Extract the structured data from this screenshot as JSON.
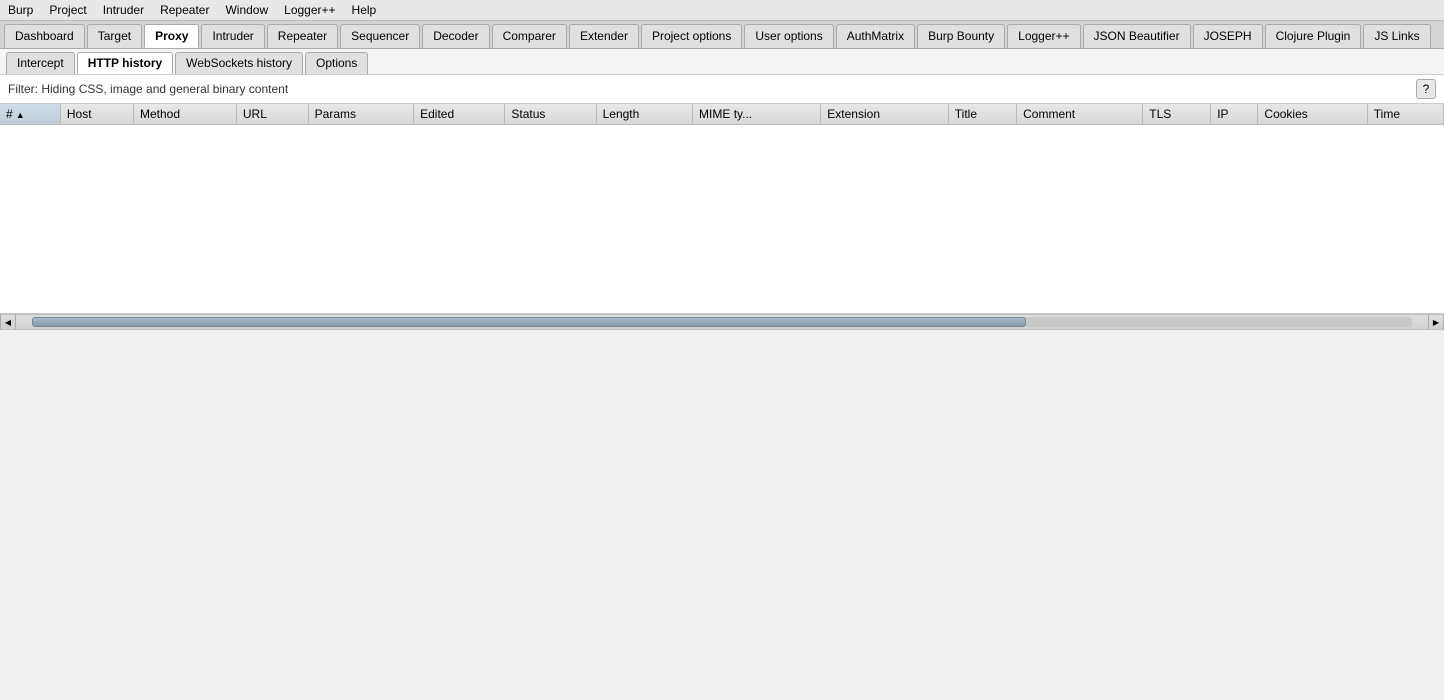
{
  "menu": {
    "items": [
      "Burp",
      "Project",
      "Intruder",
      "Repeater",
      "Window",
      "Logger++",
      "Help"
    ]
  },
  "main_tabs": [
    {
      "label": "Dashboard",
      "active": false
    },
    {
      "label": "Target",
      "active": false
    },
    {
      "label": "Proxy",
      "active": true
    },
    {
      "label": "Intruder",
      "active": false
    },
    {
      "label": "Repeater",
      "active": false
    },
    {
      "label": "Sequencer",
      "active": false
    },
    {
      "label": "Decoder",
      "active": false
    },
    {
      "label": "Comparer",
      "active": false
    },
    {
      "label": "Extender",
      "active": false
    },
    {
      "label": "Project options",
      "active": false
    },
    {
      "label": "User options",
      "active": false
    },
    {
      "label": "AuthMatrix",
      "active": false
    },
    {
      "label": "Burp Bounty",
      "active": false
    },
    {
      "label": "Logger++",
      "active": false
    },
    {
      "label": "JSON Beautifier",
      "active": false
    },
    {
      "label": "JOSEPH",
      "active": false
    },
    {
      "label": "Clojure Plugin",
      "active": false
    },
    {
      "label": "JS Links",
      "active": false
    }
  ],
  "sub_tabs": [
    {
      "label": "Intercept",
      "active": false
    },
    {
      "label": "HTTP history",
      "active": true
    },
    {
      "label": "WebSockets history",
      "active": false
    },
    {
      "label": "Options",
      "active": false
    }
  ],
  "filter": {
    "text": "Filter: Hiding CSS, image and general binary content",
    "help_label": "?"
  },
  "table": {
    "columns": [
      {
        "label": "#",
        "sorted": true,
        "sort_dir": "▲"
      },
      {
        "label": "Host"
      },
      {
        "label": "Method"
      },
      {
        "label": "URL"
      },
      {
        "label": "Params"
      },
      {
        "label": "Edited"
      },
      {
        "label": "Status"
      },
      {
        "label": "Length"
      },
      {
        "label": "MIME ty..."
      },
      {
        "label": "Extension"
      },
      {
        "label": "Title"
      },
      {
        "label": "Comment"
      },
      {
        "label": "TLS"
      },
      {
        "label": "IP"
      },
      {
        "label": "Cookies"
      },
      {
        "label": "Time"
      }
    ],
    "rows": []
  },
  "scrollbar": {
    "left_arrow": "◀",
    "right_arrow": "▶"
  }
}
